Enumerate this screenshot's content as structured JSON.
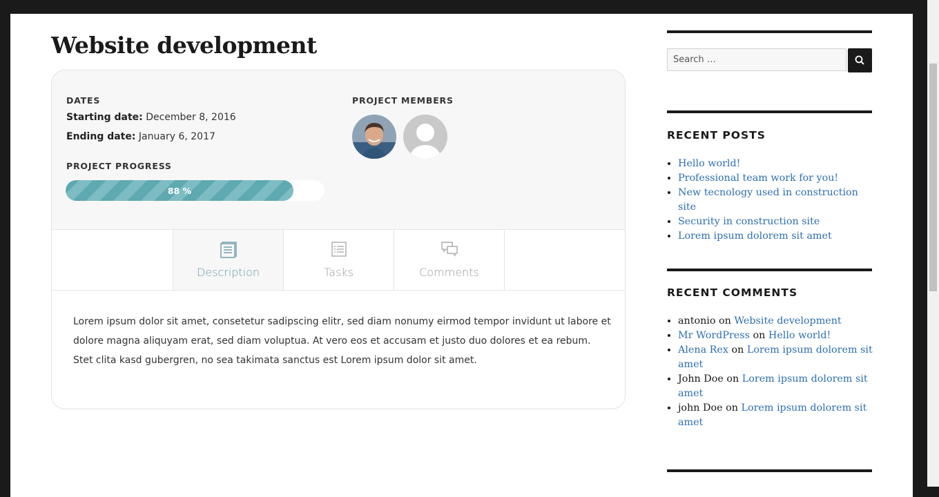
{
  "project": {
    "title": "Website development",
    "dates_label": "DATES",
    "starting_label": "Starting date:",
    "starting_value": "December 8, 2016",
    "ending_label": "Ending date:",
    "ending_value": "January 6, 2017",
    "progress_label": "PROJECT PROGRESS",
    "progress_percent": 88,
    "progress_text": "88 %",
    "members_label": "PROJECT MEMBERS",
    "members": [
      {
        "name": "member-photo",
        "type": "photo"
      },
      {
        "name": "member-placeholder",
        "type": "placeholder"
      }
    ],
    "tabs": [
      {
        "label": "Description",
        "icon": "document-icon",
        "active": true
      },
      {
        "label": "Tasks",
        "icon": "list-icon",
        "active": false
      },
      {
        "label": "Comments",
        "icon": "comments-icon",
        "active": false
      }
    ],
    "description": "Lorem ipsum dolor sit amet, consetetur sadipscing elitr, sed diam nonumy eirmod tempor invidunt ut labore et dolore magna aliquyam erat, sed diam voluptua. At vero eos et accusam et justo duo dolores et ea rebum. Stet clita kasd gubergren, no sea takimata sanctus est Lorem ipsum dolor sit amet."
  },
  "sidebar": {
    "search": {
      "placeholder": "Search …",
      "icon": "search-icon"
    },
    "recent_posts": {
      "title": "RECENT POSTS",
      "items": [
        "Hello world!",
        "Professional team work for you!",
        "New tecnology used in construction site",
        "Security in construction site",
        "Lorem ipsum dolorem sit amet"
      ]
    },
    "recent_comments": {
      "title": "RECENT COMMENTS",
      "connector": "on",
      "items": [
        {
          "author": "antonio",
          "author_link": false,
          "post": "Website development"
        },
        {
          "author": "Mr WordPress",
          "author_link": true,
          "post": "Hello world!"
        },
        {
          "author": "Alena Rex",
          "author_link": true,
          "post": "Lorem ipsum dolorem sit amet"
        },
        {
          "author": "John Doe",
          "author_link": false,
          "post": "Lorem ipsum dolorem sit amet"
        },
        {
          "author": "john Doe",
          "author_link": false,
          "post": "Lorem ipsum dolorem sit amet"
        }
      ]
    }
  },
  "colors": {
    "accent": "#5fa9b0",
    "link": "#2e6fb0",
    "dark": "#1a1a1a"
  }
}
